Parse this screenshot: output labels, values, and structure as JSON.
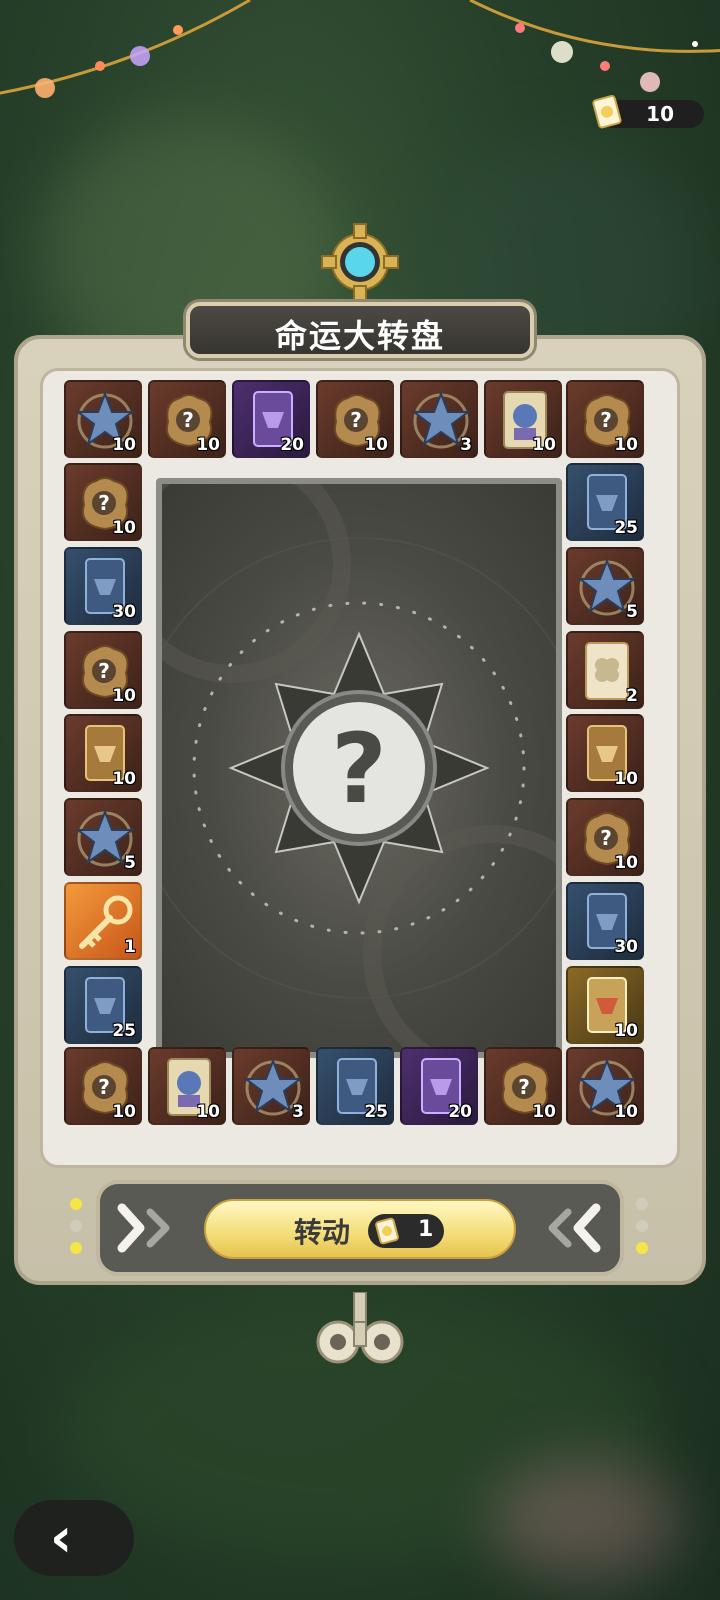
{
  "header": {
    "ticket_count": "10"
  },
  "title": "命运大转盘",
  "wheel": {
    "center_symbol": "?"
  },
  "spin": {
    "label": "转动",
    "cost": "1"
  },
  "colors": {
    "accent_yellow": "#f3dd77",
    "frame_beige": "#d8d2bd",
    "panel": "#ebe9e2",
    "highlight_orange": "#e47a24"
  },
  "tiles": {
    "top": [
      {
        "icon": "star-badge-icon",
        "qty": "10",
        "bg": "brown"
      },
      {
        "icon": "mystery-pouch-icon",
        "qty": "10",
        "bg": "brown"
      },
      {
        "icon": "purple-card-icon",
        "qty": "20",
        "bg": "purple"
      },
      {
        "icon": "mystery-pouch-icon",
        "qty": "10",
        "bg": "brown"
      },
      {
        "icon": "star-badge-icon",
        "qty": "3",
        "bg": "brown"
      },
      {
        "icon": "character-card-icon",
        "qty": "10",
        "bg": "brown"
      },
      {
        "icon": "mystery-pouch-icon",
        "qty": "10",
        "bg": "brown"
      }
    ],
    "left": [
      {
        "icon": "mystery-pouch-icon",
        "qty": "10",
        "bg": "brown"
      },
      {
        "icon": "blue-card-icon",
        "qty": "30",
        "bg": "blue"
      },
      {
        "icon": "mystery-pouch-icon",
        "qty": "10",
        "bg": "brown"
      },
      {
        "icon": "gold-card-icon",
        "qty": "10",
        "bg": "brown"
      },
      {
        "icon": "star-badge-icon",
        "qty": "5",
        "bg": "brown"
      },
      {
        "icon": "golden-key-icon",
        "qty": "1",
        "bg": "orange"
      },
      {
        "icon": "blue-card-icon",
        "qty": "25",
        "bg": "blue"
      }
    ],
    "right": [
      {
        "icon": "blue-card-icon",
        "qty": "25",
        "bg": "blue"
      },
      {
        "icon": "star-badge-icon",
        "qty": "5",
        "bg": "brown"
      },
      {
        "icon": "clover-card-icon",
        "qty": "2",
        "bg": "brown"
      },
      {
        "icon": "gold-card-icon",
        "qty": "10",
        "bg": "brown"
      },
      {
        "icon": "mystery-pouch-icon",
        "qty": "10",
        "bg": "brown"
      },
      {
        "icon": "blue-card-icon",
        "qty": "30",
        "bg": "blue"
      },
      {
        "icon": "red-card-icon",
        "qty": "10",
        "bg": "gold"
      }
    ],
    "bottom": [
      {
        "icon": "mystery-pouch-icon",
        "qty": "10",
        "bg": "brown"
      },
      {
        "icon": "character-card-icon",
        "qty": "10",
        "bg": "brown"
      },
      {
        "icon": "star-badge-icon",
        "qty": "3",
        "bg": "brown"
      },
      {
        "icon": "blue-card-icon",
        "qty": "25",
        "bg": "blue"
      },
      {
        "icon": "purple-card-icon",
        "qty": "20",
        "bg": "purple"
      },
      {
        "icon": "mystery-pouch-icon",
        "qty": "10",
        "bg": "brown"
      },
      {
        "icon": "star-badge-icon",
        "qty": "10",
        "bg": "brown"
      }
    ]
  }
}
